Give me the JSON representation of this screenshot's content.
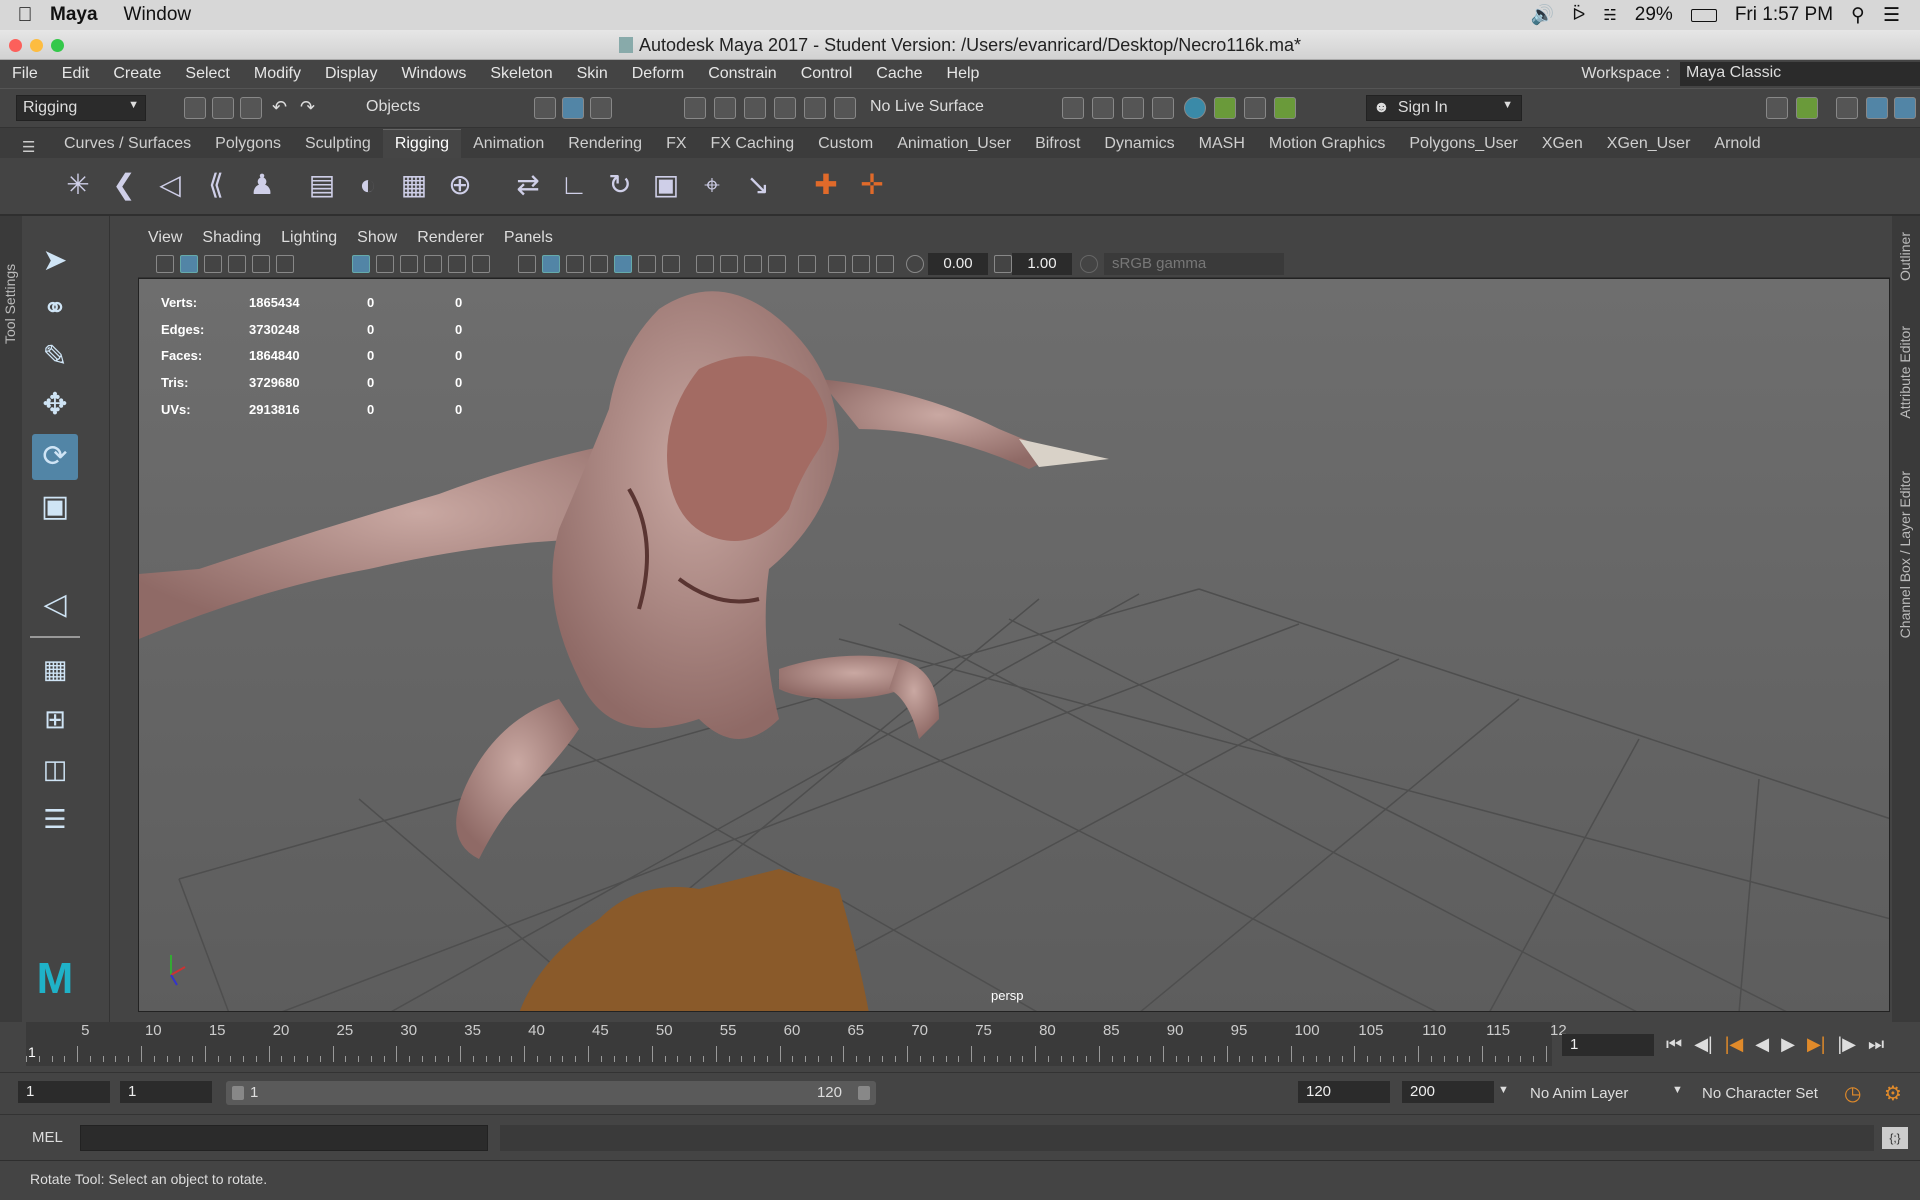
{
  "macbar": {
    "app": "Maya",
    "window": "Window",
    "battery": "29%",
    "clock": "Fri 1:57 PM"
  },
  "title": "Autodesk Maya 2017 - Student Version: /Users/evanricard/Desktop/Necro116k.ma*",
  "menus": [
    "File",
    "Edit",
    "Create",
    "Select",
    "Modify",
    "Display",
    "Windows",
    "Skeleton",
    "Skin",
    "Deform",
    "Constrain",
    "Control",
    "Cache",
    "Help"
  ],
  "workspace": {
    "label": "Workspace :",
    "value": "Maya Classic"
  },
  "status": {
    "menuset": "Rigging",
    "select_mode": "Objects",
    "live_surface": "No Live Surface",
    "sign_in": "Sign In"
  },
  "shelf_tabs": [
    "Curves / Surfaces",
    "Polygons",
    "Sculpting",
    "Rigging",
    "Animation",
    "Rendering",
    "FX",
    "FX Caching",
    "Custom",
    "Animation_User",
    "Bifrost",
    "Dynamics",
    "MASH",
    "Motion Graphics",
    "Polygons_User",
    "XGen",
    "XGen_User",
    "Arnold"
  ],
  "active_shelf": "Rigging",
  "left_tab": "Tool Settings",
  "panel_menus": [
    "View",
    "Shading",
    "Lighting",
    "Show",
    "Renderer",
    "Panels"
  ],
  "panel_tools": {
    "exposure": "0.00",
    "gamma": "1.00",
    "colorspace": "sRGB gamma"
  },
  "hud": [
    {
      "label": "Verts:",
      "v1": "1865434",
      "v2": "0",
      "v3": "0"
    },
    {
      "label": "Edges:",
      "v1": "3730248",
      "v2": "0",
      "v3": "0"
    },
    {
      "label": "Faces:",
      "v1": "1864840",
      "v2": "0",
      "v3": "0"
    },
    {
      "label": "Tris:",
      "v1": "3729680",
      "v2": "0",
      "v3": "0"
    },
    {
      "label": "UVs:",
      "v1": "2913816",
      "v2": "0",
      "v3": "0"
    }
  ],
  "camera": "persp",
  "right_tabs": [
    "Outliner",
    "Attribute Editor",
    "Channel Box / Layer Editor"
  ],
  "timeline": {
    "ticks": [
      "5",
      "10",
      "15",
      "20",
      "25",
      "30",
      "35",
      "40",
      "45",
      "50",
      "55",
      "60",
      "65",
      "70",
      "75",
      "80",
      "85",
      "90",
      "95",
      "100",
      "105",
      "110",
      "115",
      "12"
    ],
    "current_frame": "1",
    "start_marker": "1"
  },
  "range": {
    "start": "1",
    "playback_start": "1",
    "slider_start": "1",
    "slider_end": "120",
    "playback_end": "120",
    "end": "200",
    "anim_layer": "No Anim Layer",
    "char_set": "No Character Set"
  },
  "cmd": {
    "label": "MEL"
  },
  "help": "Rotate Tool: Select an object to rotate.",
  "colors": {
    "accent": "#5285a6",
    "viewport": "#6a6a6a",
    "ui": "#444444"
  }
}
